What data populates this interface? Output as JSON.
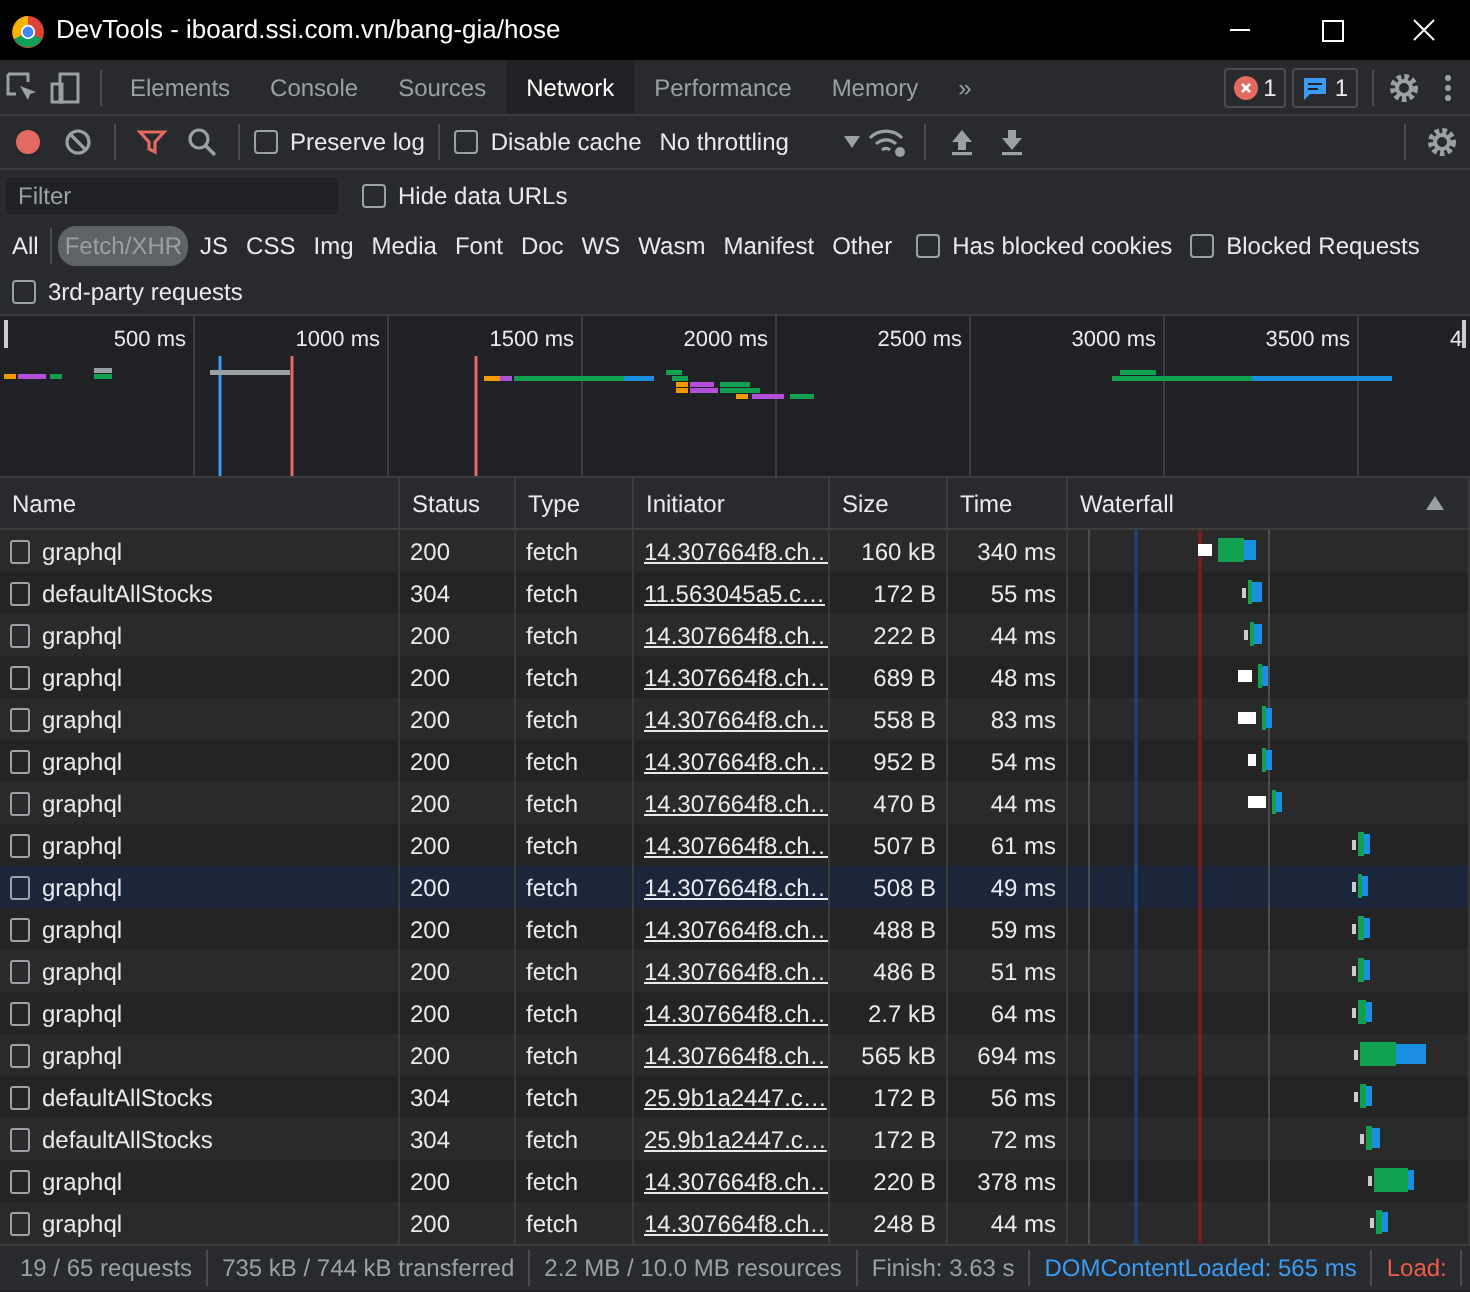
{
  "window": {
    "title": "DevTools - iboard.ssi.com.vn/bang-gia/hose"
  },
  "tabs": [
    {
      "label": "Elements",
      "selected": false
    },
    {
      "label": "Console",
      "selected": false
    },
    {
      "label": "Sources",
      "selected": false
    },
    {
      "label": "Network",
      "selected": true
    },
    {
      "label": "Performance",
      "selected": false
    },
    {
      "label": "Memory",
      "selected": false
    }
  ],
  "overflow_tabs": "»",
  "badges": [
    {
      "kind": "error",
      "count": "1"
    },
    {
      "kind": "message",
      "count": "1"
    }
  ],
  "toolbar": {
    "preserve_log": {
      "label": "Preserve log",
      "checked": false
    },
    "disable_cache": {
      "label": "Disable cache",
      "checked": false
    },
    "throttling": "No throttling"
  },
  "filter": {
    "placeholder": "Filter",
    "hide_data_urls": {
      "label": "Hide data URLs",
      "checked": false
    }
  },
  "types": [
    {
      "label": "All",
      "selected": false
    },
    {
      "label": "Fetch/XHR",
      "selected": true
    },
    {
      "label": "JS",
      "selected": false
    },
    {
      "label": "CSS",
      "selected": false
    },
    {
      "label": "Img",
      "selected": false
    },
    {
      "label": "Media",
      "selected": false
    },
    {
      "label": "Font",
      "selected": false
    },
    {
      "label": "Doc",
      "selected": false
    },
    {
      "label": "WS",
      "selected": false
    },
    {
      "label": "Wasm",
      "selected": false
    },
    {
      "label": "Manifest",
      "selected": false
    },
    {
      "label": "Other",
      "selected": false
    }
  ],
  "type_checkboxes": [
    {
      "label": "Has blocked cookies",
      "checked": false
    },
    {
      "label": "Blocked Requests",
      "checked": false
    }
  ],
  "third_party": {
    "label": "3rd-party requests",
    "checked": false
  },
  "overview": {
    "tick_labels": [
      "500 ms",
      "1000 ms",
      "1500 ms",
      "2000 ms",
      "2500 ms",
      "3000 ms",
      "3500 ms",
      "4"
    ]
  },
  "table": {
    "columns": [
      "Name",
      "Status",
      "Type",
      "Initiator",
      "Size",
      "Time",
      "Waterfall"
    ],
    "rows": [
      {
        "name": "graphql",
        "status": "200",
        "type": "fetch",
        "initiator": "14.307664f8.ch…",
        "size": "160 kB",
        "time": "340 ms",
        "selected": false
      },
      {
        "name": "defaultAllStocks",
        "status": "304",
        "type": "fetch",
        "initiator": "11.563045a5.c…",
        "size": "172 B",
        "time": "55 ms",
        "selected": false
      },
      {
        "name": "graphql",
        "status": "200",
        "type": "fetch",
        "initiator": "14.307664f8.ch…",
        "size": "222 B",
        "time": "44 ms",
        "selected": false
      },
      {
        "name": "graphql",
        "status": "200",
        "type": "fetch",
        "initiator": "14.307664f8.ch…",
        "size": "689 B",
        "time": "48 ms",
        "selected": false
      },
      {
        "name": "graphql",
        "status": "200",
        "type": "fetch",
        "initiator": "14.307664f8.ch…",
        "size": "558 B",
        "time": "83 ms",
        "selected": false
      },
      {
        "name": "graphql",
        "status": "200",
        "type": "fetch",
        "initiator": "14.307664f8.ch…",
        "size": "952 B",
        "time": "54 ms",
        "selected": false
      },
      {
        "name": "graphql",
        "status": "200",
        "type": "fetch",
        "initiator": "14.307664f8.ch…",
        "size": "470 B",
        "time": "44 ms",
        "selected": false
      },
      {
        "name": "graphql",
        "status": "200",
        "type": "fetch",
        "initiator": "14.307664f8.ch…",
        "size": "507 B",
        "time": "61 ms",
        "selected": false
      },
      {
        "name": "graphql",
        "status": "200",
        "type": "fetch",
        "initiator": "14.307664f8.ch…",
        "size": "508 B",
        "time": "49 ms",
        "selected": true
      },
      {
        "name": "graphql",
        "status": "200",
        "type": "fetch",
        "initiator": "14.307664f8.ch…",
        "size": "488 B",
        "time": "59 ms",
        "selected": false
      },
      {
        "name": "graphql",
        "status": "200",
        "type": "fetch",
        "initiator": "14.307664f8.ch…",
        "size": "486 B",
        "time": "51 ms",
        "selected": false
      },
      {
        "name": "graphql",
        "status": "200",
        "type": "fetch",
        "initiator": "14.307664f8.ch…",
        "size": "2.7 kB",
        "time": "64 ms",
        "selected": false
      },
      {
        "name": "graphql",
        "status": "200",
        "type": "fetch",
        "initiator": "14.307664f8.ch…",
        "size": "565 kB",
        "time": "694 ms",
        "selected": false
      },
      {
        "name": "defaultAllStocks",
        "status": "304",
        "type": "fetch",
        "initiator": "25.9b1a2447.c…",
        "size": "172 B",
        "time": "56 ms",
        "selected": false
      },
      {
        "name": "defaultAllStocks",
        "status": "304",
        "type": "fetch",
        "initiator": "25.9b1a2447.c…",
        "size": "172 B",
        "time": "72 ms",
        "selected": false
      },
      {
        "name": "graphql",
        "status": "200",
        "type": "fetch",
        "initiator": "14.307664f8.ch…",
        "size": "220 B",
        "time": "378 ms",
        "selected": false
      },
      {
        "name": "graphql",
        "status": "200",
        "type": "fetch",
        "initiator": "14.307664f8.ch…",
        "size": "248 B",
        "time": "44 ms",
        "selected": false
      }
    ]
  },
  "status_bar": [
    {
      "kind": "plain",
      "text": "19 / 65 requests"
    },
    {
      "kind": "plain",
      "text": "735 kB / 744 kB transferred"
    },
    {
      "kind": "plain",
      "text": "2.2 MB / 10.0 MB resources"
    },
    {
      "kind": "plain",
      "text": "Finish: 3.63 s"
    },
    {
      "kind": "dom",
      "text": "DOMContentLoaded: 565 ms"
    },
    {
      "kind": "load",
      "text": "Load:"
    }
  ]
}
